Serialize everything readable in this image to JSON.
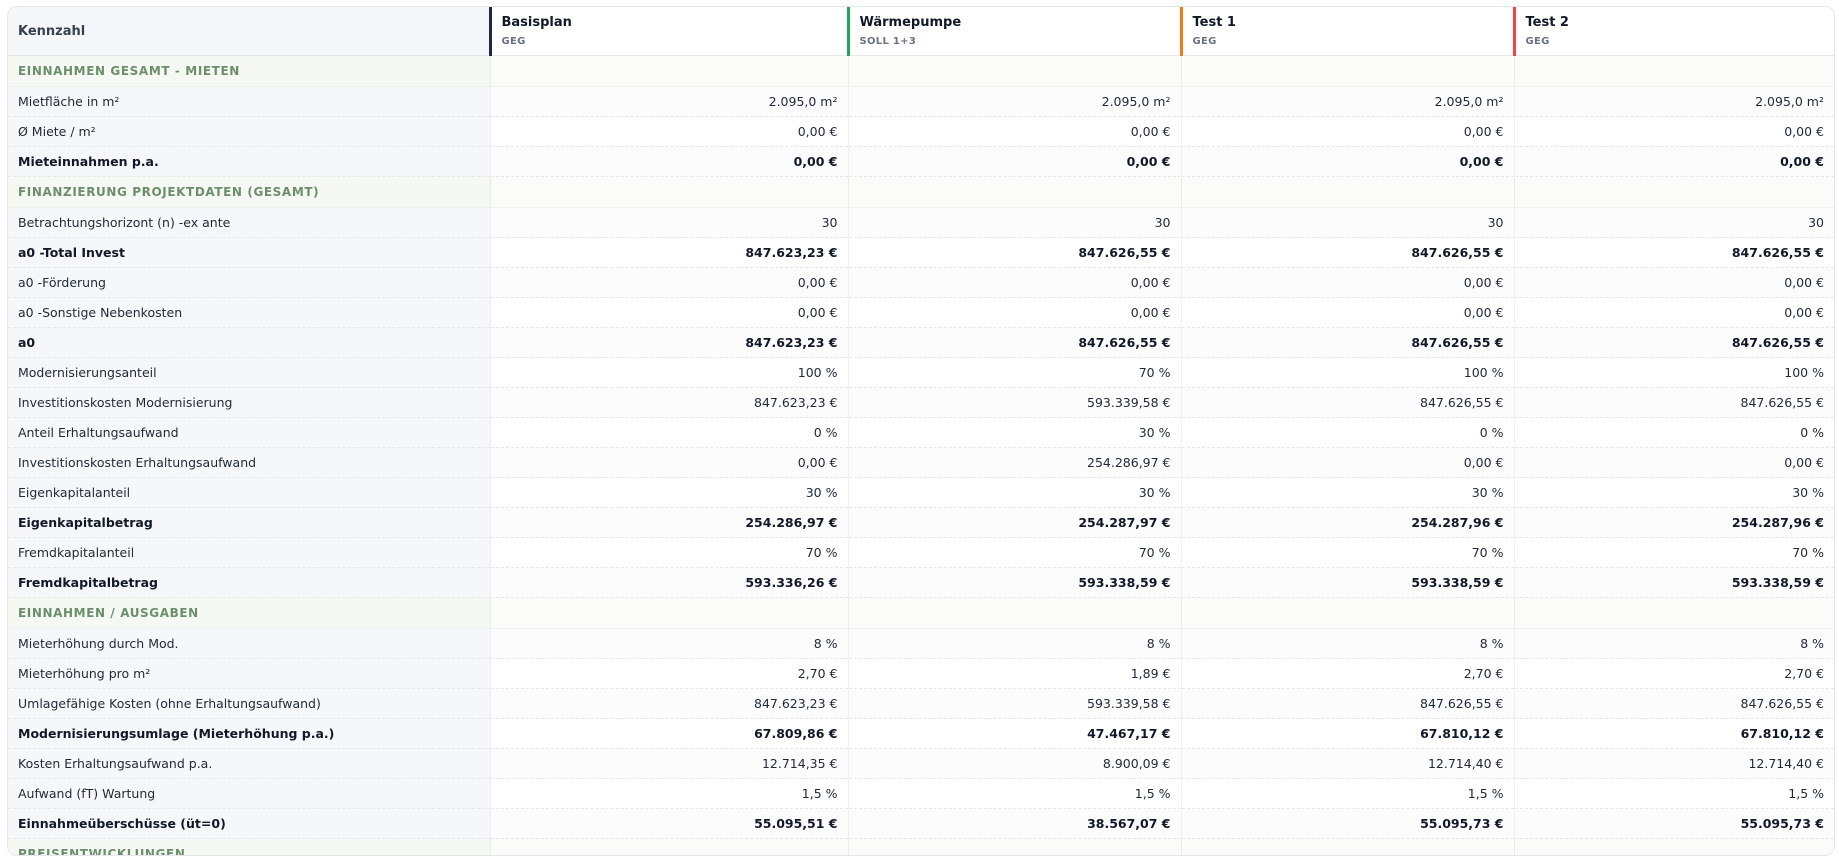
{
  "header": {
    "label": "Kennzahl",
    "scenarios": [
      {
        "name": "Basisplan",
        "sub": "GEG",
        "color": "#1f2937"
      },
      {
        "name": "Wärmepumpe",
        "sub": "SOLL 1+3",
        "color": "#22a55b"
      },
      {
        "name": "Test 1",
        "sub": "GEG",
        "color": "#f07a1a"
      },
      {
        "name": "Test 2",
        "sub": "GEG",
        "color": "#ef4444"
      }
    ]
  },
  "rows": [
    {
      "type": "section",
      "label": "EINNAHMEN GESAMT - MIETEN"
    },
    {
      "type": "data",
      "label": "Mietfläche in m²",
      "values": [
        "2.095,0 m²",
        "2.095,0 m²",
        "2.095,0 m²",
        "2.095,0 m²"
      ]
    },
    {
      "type": "data",
      "label": "Ø Miete / m²",
      "values": [
        "0,00 €",
        "0,00 €",
        "0,00 €",
        "0,00 €"
      ]
    },
    {
      "type": "data",
      "bold": true,
      "label": "Mieteinnahmen p.a.",
      "values": [
        "0,00 €",
        "0,00 €",
        "0,00 €",
        "0,00 €"
      ]
    },
    {
      "type": "section",
      "label": "FINANZIERUNG PROJEKTDATEN (GESAMT)"
    },
    {
      "type": "data",
      "label": "Betrachtungshorizont (n) -ex ante",
      "values": [
        "30",
        "30",
        "30",
        "30"
      ]
    },
    {
      "type": "data",
      "bold": true,
      "label": "a0 -Total Invest",
      "values": [
        "847.623,23 €",
        "847.626,55 €",
        "847.626,55 €",
        "847.626,55 €"
      ]
    },
    {
      "type": "data",
      "label": "a0 -Förderung",
      "values": [
        "0,00 €",
        "0,00 €",
        "0,00 €",
        "0,00 €"
      ]
    },
    {
      "type": "data",
      "label": "a0 -Sonstige Nebenkosten",
      "values": [
        "0,00 €",
        "0,00 €",
        "0,00 €",
        "0,00 €"
      ]
    },
    {
      "type": "data",
      "bold": true,
      "label": "a0",
      "values": [
        "847.623,23 €",
        "847.626,55 €",
        "847.626,55 €",
        "847.626,55 €"
      ]
    },
    {
      "type": "data",
      "label": "Modernisierungsanteil",
      "values": [
        "100 %",
        "70 %",
        "100 %",
        "100 %"
      ]
    },
    {
      "type": "data",
      "label": "Investitionskosten Modernisierung",
      "values": [
        "847.623,23 €",
        "593.339,58 €",
        "847.626,55 €",
        "847.626,55 €"
      ]
    },
    {
      "type": "data",
      "label": "Anteil Erhaltungsaufwand",
      "values": [
        "0 %",
        "30 %",
        "0 %",
        "0 %"
      ]
    },
    {
      "type": "data",
      "label": "Investitionskosten Erhaltungsaufwand",
      "values": [
        "0,00 €",
        "254.286,97 €",
        "0,00 €",
        "0,00 €"
      ]
    },
    {
      "type": "data",
      "label": "Eigenkapitalanteil",
      "values": [
        "30 %",
        "30 %",
        "30 %",
        "30 %"
      ]
    },
    {
      "type": "data",
      "bold": true,
      "label": "Eigenkapitalbetrag",
      "values": [
        "254.286,97 €",
        "254.287,97 €",
        "254.287,96 €",
        "254.287,96 €"
      ]
    },
    {
      "type": "data",
      "label": "Fremdkapitalanteil",
      "values": [
        "70 %",
        "70 %",
        "70 %",
        "70 %"
      ]
    },
    {
      "type": "data",
      "bold": true,
      "label": "Fremdkapitalbetrag",
      "values": [
        "593.336,26 €",
        "593.338,59 €",
        "593.338,59 €",
        "593.338,59 €"
      ]
    },
    {
      "type": "section",
      "label": "EINNAHMEN / AUSGABEN"
    },
    {
      "type": "data",
      "label": "Mieterhöhung durch Mod.",
      "values": [
        "8 %",
        "8 %",
        "8 %",
        "8 %"
      ]
    },
    {
      "type": "data",
      "label": "Mieterhöhung pro m²",
      "values": [
        "2,70 €",
        "1,89 €",
        "2,70 €",
        "2,70 €"
      ]
    },
    {
      "type": "data",
      "label": "Umlagefähige Kosten (ohne Erhaltungsaufwand)",
      "values": [
        "847.623,23 €",
        "593.339,58 €",
        "847.626,55 €",
        "847.626,55 €"
      ]
    },
    {
      "type": "data",
      "bold": true,
      "label": "Modernisierungsumlage (Mieterhöhung p.a.)",
      "values": [
        "67.809,86 €",
        "47.467,17 €",
        "67.810,12 €",
        "67.810,12 €"
      ]
    },
    {
      "type": "data",
      "label": "Kosten Erhaltungsaufwand p.a.",
      "values": [
        "12.714,35 €",
        "8.900,09 €",
        "12.714,40 €",
        "12.714,40 €"
      ]
    },
    {
      "type": "data",
      "label": "Aufwand (fT) Wartung",
      "values": [
        "1,5 %",
        "1,5 %",
        "1,5 %",
        "1,5 %"
      ]
    },
    {
      "type": "data",
      "bold": true,
      "label": "Einnahmeüberschüsse (üt=0)",
      "values": [
        "55.095,51 €",
        "38.567,07 €",
        "55.095,73 €",
        "55.095,73 €"
      ]
    },
    {
      "type": "section",
      "label": "PREISENTWICKLUNGEN"
    }
  ]
}
